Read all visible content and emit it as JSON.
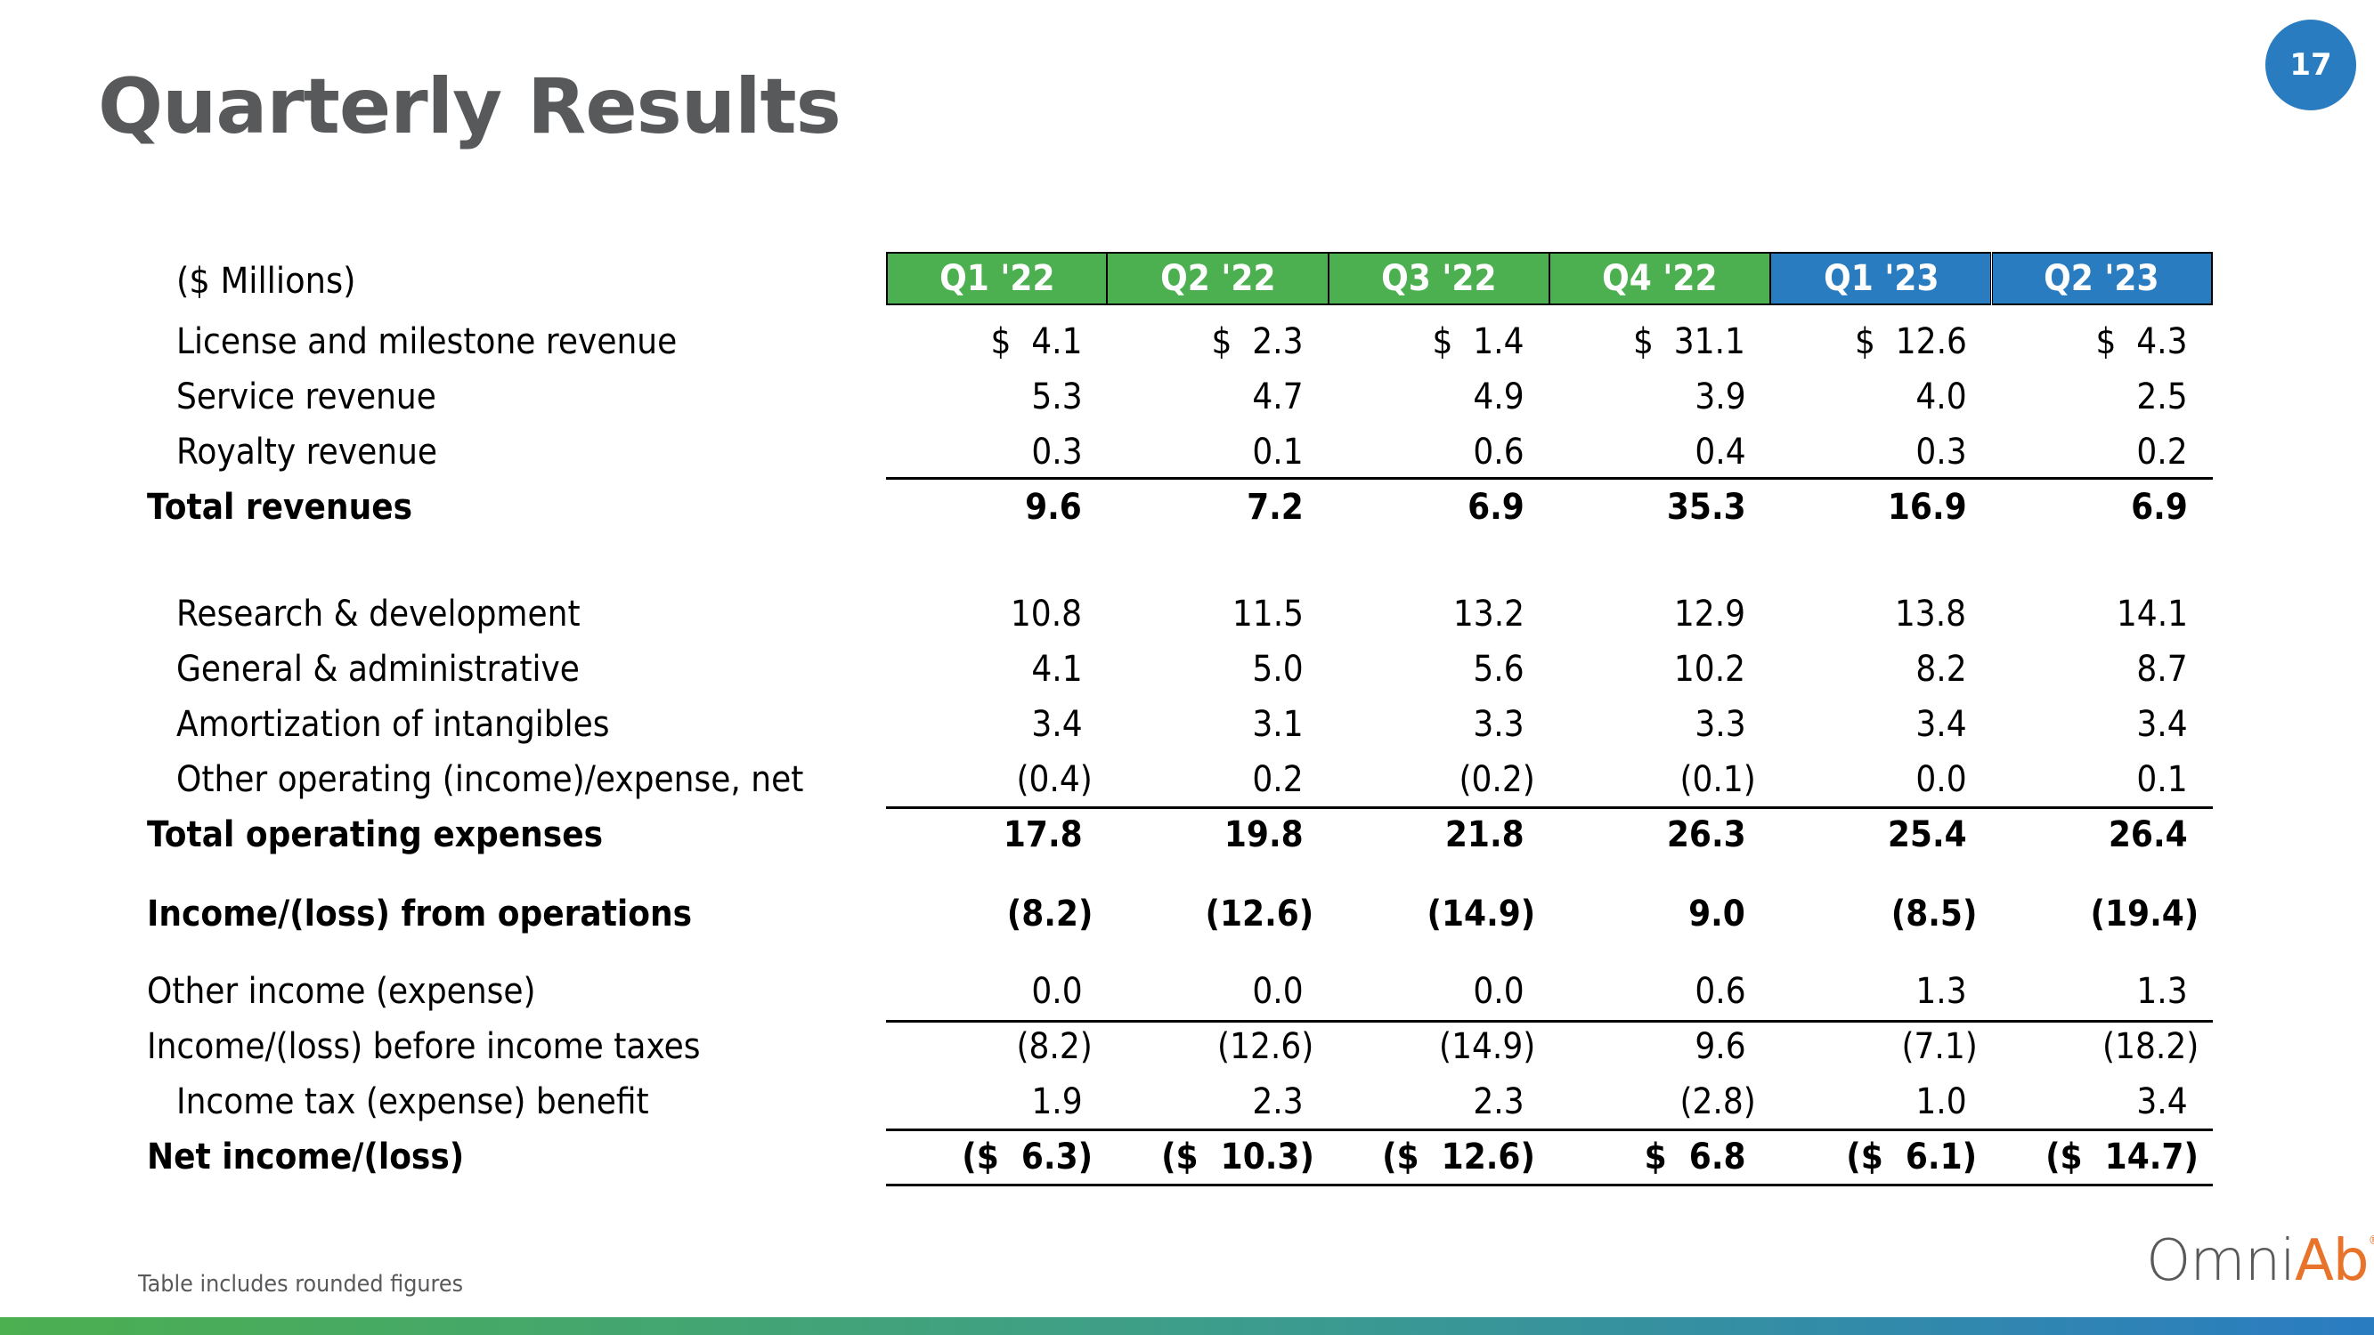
{
  "slide": {
    "title": "Quarterly Results",
    "page_number": "17",
    "footnote": "Table includes rounded figures",
    "logo": {
      "part1": "Omni",
      "part2": "Ab",
      "mark": "®"
    },
    "colors": {
      "title_gray": "#58595b",
      "header_green": "#4caf50",
      "header_blue": "#2a7cc1",
      "logo_orange": "#e8732b"
    }
  },
  "table": {
    "units_label": "($ Millions)",
    "columns": [
      {
        "label": "Q1 '22",
        "color": "#4caf50"
      },
      {
        "label": "Q2 '22",
        "color": "#4caf50"
      },
      {
        "label": "Q3 '22",
        "color": "#4caf50"
      },
      {
        "label": "Q4 '22",
        "color": "#4caf50"
      },
      {
        "label": "Q1 '23",
        "color": "#2a7cc1"
      },
      {
        "label": "Q2 '23",
        "color": "#2a7cc1"
      }
    ],
    "rows": [
      {
        "label": "License and milestone revenue",
        "values": [
          "$  4.1",
          "$  2.3",
          "$  1.4",
          "$  31.1",
          "$  12.6",
          "$  4.3"
        ]
      },
      {
        "label": "Service revenue",
        "values": [
          "5.3",
          "4.7",
          "4.9",
          "3.9",
          "4.0",
          "2.5"
        ]
      },
      {
        "label": "Royalty revenue",
        "values": [
          "0.3",
          "0.1",
          "0.6",
          "0.4",
          "0.3",
          "0.2"
        ]
      },
      {
        "label": "Total revenues",
        "values": [
          "9.6",
          "7.2",
          "6.9",
          "35.3",
          "16.9",
          "6.9"
        ]
      },
      {
        "label": "Research & development",
        "values": [
          "10.8",
          "11.5",
          "13.2",
          "12.9",
          "13.8",
          "14.1"
        ]
      },
      {
        "label": "General & administrative",
        "values": [
          "4.1",
          "5.0",
          "5.6",
          "10.2",
          "8.2",
          "8.7"
        ]
      },
      {
        "label": "Amortization of intangibles",
        "values": [
          "3.4",
          "3.1",
          "3.3",
          "3.3",
          "3.4",
          "3.4"
        ]
      },
      {
        "label": "Other operating (income)/expense, net",
        "values": [
          "(0.4)",
          "0.2",
          "(0.2)",
          "(0.1)",
          "0.0",
          "0.1"
        ]
      },
      {
        "label": "Total operating expenses",
        "values": [
          "17.8",
          "19.8",
          "21.8",
          "26.3",
          "25.4",
          "26.4"
        ]
      },
      {
        "label": "Income/(loss) from operations",
        "values": [
          "(8.2)",
          "(12.6)",
          "(14.9)",
          "9.0",
          "(8.5)",
          "(19.4)"
        ]
      },
      {
        "label": "Other income (expense)",
        "values": [
          "0.0",
          "0.0",
          "0.0",
          "0.6",
          "1.3",
          "1.3"
        ]
      },
      {
        "label": "Income/(loss) before income taxes",
        "values": [
          "(8.2)",
          "(12.6)",
          "(14.9)",
          "9.6",
          "(7.1)",
          "(18.2)"
        ]
      },
      {
        "label": "Income tax (expense) benefit",
        "values": [
          "1.9",
          "2.3",
          "2.3",
          "(2.8)",
          "1.0",
          "3.4"
        ]
      },
      {
        "label": "Net income/(loss)",
        "values": [
          "($  6.3)",
          "($  10.3)",
          "($  12.6)",
          "$  6.8",
          "($  6.1)",
          "($  14.7)"
        ]
      }
    ]
  }
}
